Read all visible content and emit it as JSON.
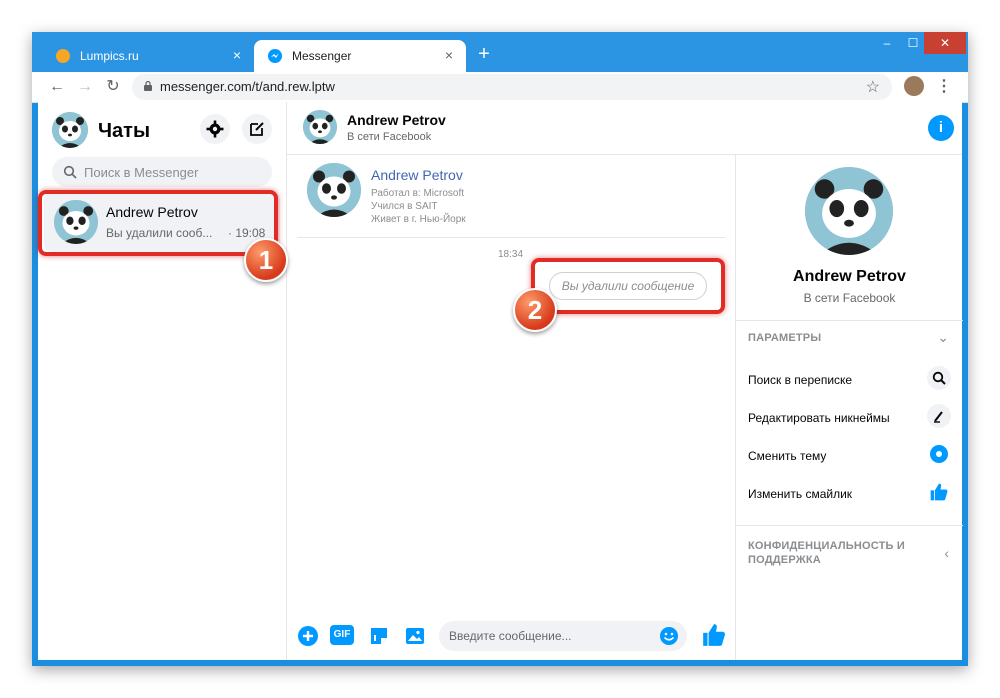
{
  "browser": {
    "tabs": [
      {
        "label": "Lumpics.ru",
        "close": "×"
      },
      {
        "label": "Messenger",
        "close": "×"
      }
    ],
    "new_tab": "+",
    "url": "messenger.com/t/and.rew.lptw",
    "window_controls": {
      "minimize": "–",
      "maximize": "☐",
      "close": "✕"
    }
  },
  "sidebar": {
    "title": "Чаты",
    "search_placeholder": "Поиск в Messenger",
    "conversation": {
      "name": "Andrew Petrov",
      "snippet": "Вы удалили сооб...",
      "time": "· 19:08"
    }
  },
  "chat": {
    "header_name": "Andrew Petrov",
    "header_status": "В сети Facebook",
    "profile": {
      "name": "Andrew Petrov",
      "work": "Работал в: Microsoft",
      "study": "Учился в SAIT",
      "lives": "Живет в г. Нью-Йорк"
    },
    "timestamp": "18:34",
    "deleted_message": "Вы удалили сообщение",
    "input_placeholder": "Введите сообщение...",
    "gif_label": "GIF"
  },
  "panel": {
    "name": "Andrew Petrov",
    "status": "В сети Facebook",
    "params_header": "ПАРАМЕТРЫ",
    "options": [
      {
        "label": "Поиск в переписке",
        "icon": "search-icon"
      },
      {
        "label": "Редактировать никнеймы",
        "icon": "pencil-icon"
      },
      {
        "label": "Сменить тему",
        "icon": "theme-icon"
      },
      {
        "label": "Изменить смайлик",
        "icon": "thumbs-up-icon"
      }
    ],
    "privacy_header": "КОНФИДЕНЦИАЛЬНОСТЬ И ПОДДЕРЖКА"
  },
  "annotations": {
    "badge1": "1",
    "badge2": "2"
  },
  "colors": {
    "accent": "#0099ff",
    "highlight": "#e22b25",
    "titlebar": "#2b95e4"
  }
}
